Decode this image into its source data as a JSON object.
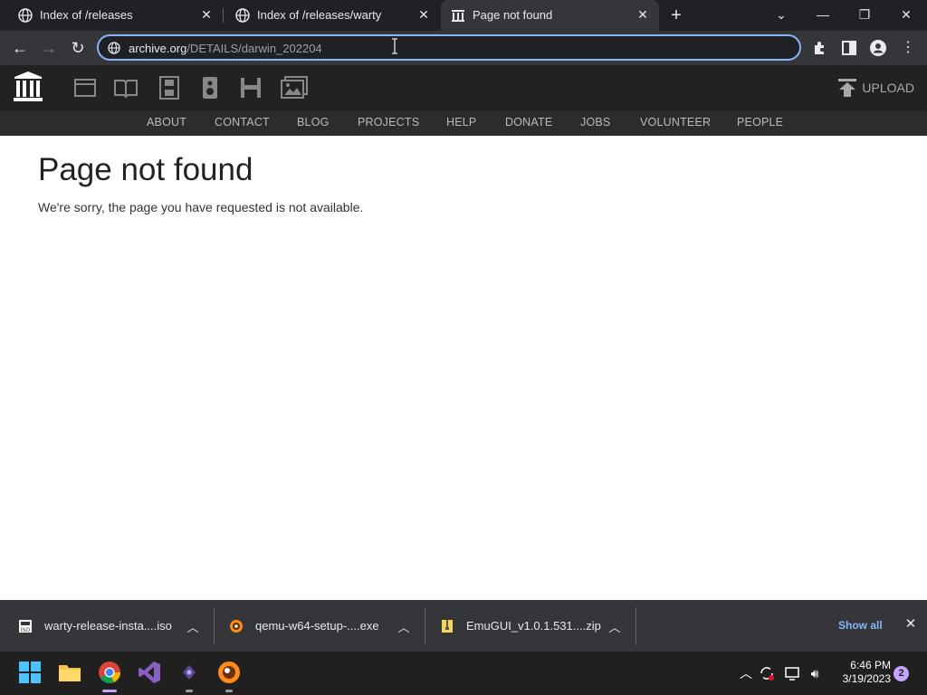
{
  "browser": {
    "tabs": [
      {
        "title": "Index of /releases",
        "icon": "globe-icon"
      },
      {
        "title": "Index of /releases/warty",
        "icon": "globe-icon"
      },
      {
        "title": "Page not found",
        "icon": "archive-logo-icon",
        "active": true
      }
    ],
    "url_host": "archive.org",
    "url_path": "/DETAILS/darwin_202204",
    "accent_color": "#8ab4f8"
  },
  "site": {
    "upload_label": "UPLOAD",
    "media_icons": [
      "web-icon",
      "texts-icon",
      "video-icon",
      "audio-icon",
      "software-icon",
      "images-icon"
    ],
    "nav": [
      "ABOUT",
      "CONTACT",
      "BLOG",
      "PROJECTS",
      "HELP",
      "DONATE",
      "JOBS",
      "VOLUNTEER",
      "PEOPLE"
    ]
  },
  "page": {
    "title": "Page not found",
    "message": "We're sorry, the page you have requested is not available."
  },
  "downloads": {
    "items": [
      {
        "name": "warty-release-insta....iso",
        "icon": "iso-file-icon"
      },
      {
        "name": "qemu-w64-setup-....exe",
        "icon": "qemu-icon"
      },
      {
        "name": "EmuGUI_v1.0.1.531....zip",
        "icon": "zip-file-icon"
      }
    ],
    "show_all": "Show all"
  },
  "taskbar": {
    "apps": [
      "windows-start-icon",
      "file-explorer-icon",
      "chrome-icon",
      "visual-studio-icon",
      "emulator-icon",
      "qemu-icon"
    ],
    "time": "6:46 PM",
    "date": "3/19/2023",
    "notifications": "2"
  }
}
